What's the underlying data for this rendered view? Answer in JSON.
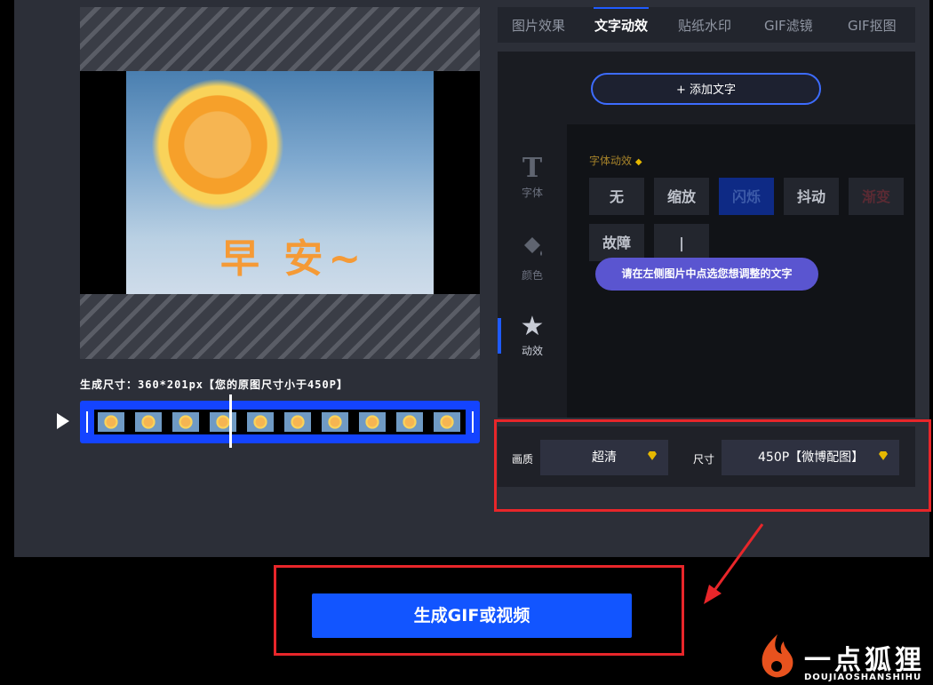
{
  "tabs": [
    "图片效果",
    "文字动效",
    "贴纸水印",
    "GIF滤镜",
    "GIF抠图"
  ],
  "active_tab": "文字动效",
  "add_text_label": "+ 添加文字",
  "side_nav": [
    {
      "icon": "T",
      "label": "字体"
    },
    {
      "icon": "paint-bucket-icon",
      "label": "颜色"
    },
    {
      "icon": "star-icon",
      "label": "动效"
    }
  ],
  "animation_section_label": "字体动效",
  "animation_options": [
    "无",
    "缩放",
    "闪烁",
    "抖动",
    "渐变",
    "故障",
    "|"
  ],
  "selected_animation": "闪烁",
  "tooltip": "请在左侧图片中点选您想调整的文字",
  "preview_caption": "早 安~",
  "size_info": "生成尺寸：360*201px【您的原图尺寸小于450P】",
  "quality_label": "画质",
  "quality_value": "超清",
  "size_label": "尺寸",
  "size_value": "450P【微博配图】",
  "generate_button": "生成GIF或视频",
  "watermark_logo": "一点狐狸",
  "watermark_sub": "DOUJIAOSHANSHIHU",
  "colors": {
    "accent": "#1255ff",
    "annotation": "#e8262a",
    "premium": "#e6b800"
  }
}
